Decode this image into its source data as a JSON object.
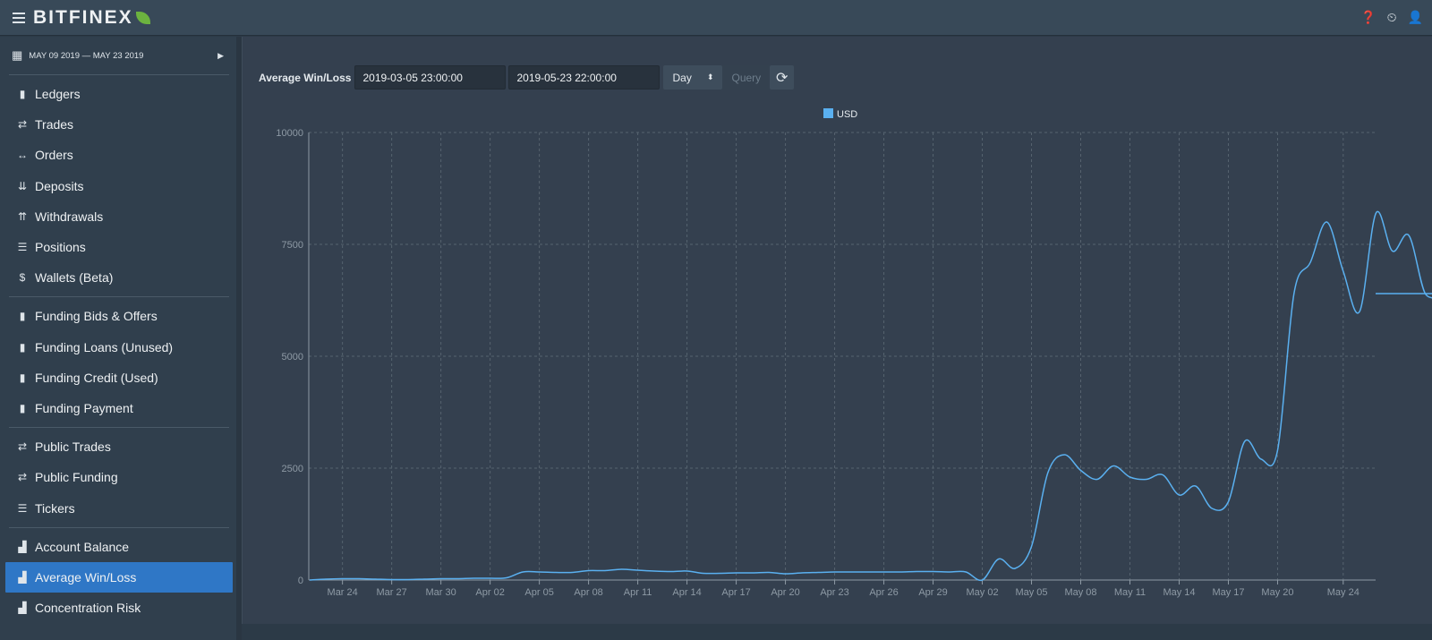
{
  "header": {
    "brand": "BITFINEX",
    "icons": [
      "help-icon",
      "changelog-icon",
      "user-icon"
    ]
  },
  "sidebar": {
    "date_range": "MAY 09 2019 — MAY 23 2019",
    "groups": [
      [
        {
          "label": "Ledgers",
          "icon": "ledger-icon"
        },
        {
          "label": "Trades",
          "icon": "trades-icon"
        },
        {
          "label": "Orders",
          "icon": "orders-icon"
        },
        {
          "label": "Deposits",
          "icon": "deposits-icon"
        },
        {
          "label": "Withdrawals",
          "icon": "withdrawals-icon"
        },
        {
          "label": "Positions",
          "icon": "positions-icon"
        },
        {
          "label": "Wallets (Beta)",
          "icon": "dollar-icon"
        }
      ],
      [
        {
          "label": "Funding Bids & Offers",
          "icon": "ledger-icon"
        },
        {
          "label": "Funding Loans (Unused)",
          "icon": "ledger-icon"
        },
        {
          "label": "Funding Credit (Used)",
          "icon": "ledger-icon"
        },
        {
          "label": "Funding Payment",
          "icon": "ledger-icon"
        }
      ],
      [
        {
          "label": "Public Trades",
          "icon": "trades-icon"
        },
        {
          "label": "Public Funding",
          "icon": "trades-icon"
        },
        {
          "label": "Tickers",
          "icon": "list-icon"
        }
      ],
      [
        {
          "label": "Account Balance",
          "icon": "chart-icon"
        },
        {
          "label": "Average Win/Loss",
          "icon": "chart-icon",
          "active": true
        },
        {
          "label": "Concentration Risk",
          "icon": "chart-icon"
        }
      ]
    ]
  },
  "toolbar": {
    "title": "Average Win/Loss",
    "start": "2019-03-05 23:00:00",
    "end": "2019-05-23 22:00:00",
    "timeframe": "Day",
    "query_label": "Query"
  },
  "chart_data": {
    "type": "line",
    "legend": [
      "USD"
    ],
    "legend_position": "top",
    "series": [
      {
        "name": "USD",
        "color": "#5ab0f0",
        "start_date": "2019-03-22",
        "values": [
          0,
          20,
          30,
          30,
          20,
          10,
          10,
          20,
          30,
          30,
          40,
          40,
          50,
          180,
          180,
          170,
          170,
          210,
          210,
          240,
          220,
          200,
          190,
          200,
          150,
          150,
          160,
          160,
          170,
          140,
          160,
          170,
          180,
          180,
          180,
          180,
          180,
          190,
          190,
          180,
          180,
          0,
          470,
          260,
          750,
          2400,
          2800,
          2450,
          2250,
          2550,
          2300,
          2250,
          2350,
          1900,
          2100,
          1600,
          1750,
          3100,
          2700,
          2900,
          6400,
          7100,
          8000,
          6900,
          6000,
          8200,
          7350,
          7700,
          6400,
          6400
        ]
      }
    ],
    "x_ticks": [
      "Mar 24",
      "Mar 27",
      "Mar 30",
      "Apr 02",
      "Apr 05",
      "Apr 08",
      "Apr 11",
      "Apr 14",
      "Apr 17",
      "Apr 20",
      "Apr 23",
      "Apr 26",
      "Apr 29",
      "May 02",
      "May 05",
      "May 08",
      "May 11",
      "May 14",
      "May 17",
      "May 20",
      "May 24"
    ],
    "y_ticks": [
      "0",
      "2500",
      "5000",
      "7500",
      "10000"
    ],
    "ylim": [
      0,
      10000
    ],
    "grid": true
  }
}
